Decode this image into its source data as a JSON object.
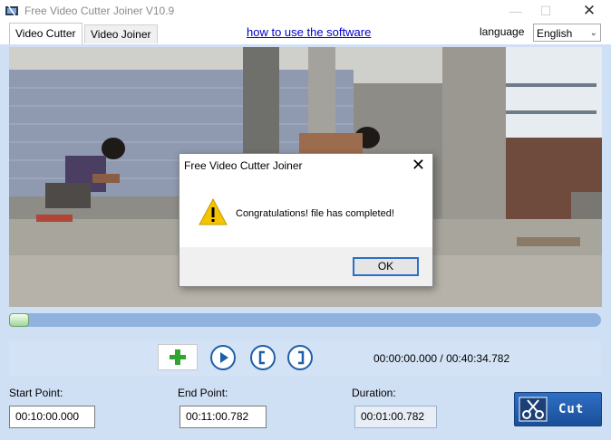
{
  "window": {
    "title": "Free Video Cutter Joiner V10.9",
    "minimize": "—",
    "maximize": "☐",
    "close": "✕"
  },
  "tabs": [
    {
      "label": "Video Cutter",
      "active": true
    },
    {
      "label": "Video Joiner",
      "active": false
    }
  ],
  "header": {
    "help_link": "how to use the software",
    "language_label": "language",
    "language_value": "English"
  },
  "player": {
    "progress_fraction": 0.0,
    "time_readout": "00:00:00.000 / 00:40:34.782"
  },
  "fields": {
    "start_label": "Start Point:",
    "start_value": "00:10:00.000",
    "end_label": "End Point:",
    "end_value": "00:11:00.782",
    "duration_label": "Duration:",
    "duration_value": "00:01:00.782"
  },
  "cut_button": {
    "label": "Cut"
  },
  "dialog": {
    "title": "Free Video Cutter Joiner",
    "message": "Congratulations! file has completed!",
    "ok_label": "OK"
  },
  "colors": {
    "accent": "#1f5fa8",
    "panel": "#cfe0f4",
    "seek_track": "#8fb2de",
    "warning": "#f5c400"
  },
  "icons": [
    "app-icon",
    "add-icon",
    "play-icon",
    "mark-start-icon",
    "mark-end-icon",
    "scissors-icon",
    "warning-icon",
    "chevron-down-icon"
  ]
}
